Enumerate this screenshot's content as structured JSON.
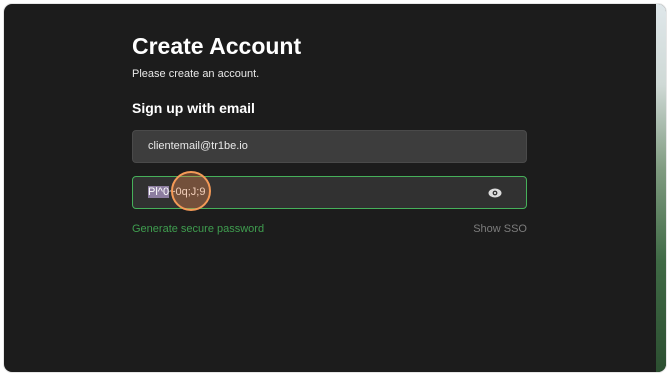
{
  "form": {
    "title": "Create Account",
    "subtitle": "Please create an account.",
    "section_title": "Sign up with email",
    "email_value": "clientemail@tr1be.io",
    "password_selected": "Pl^0",
    "password_rest": "~0q;J;9",
    "generate_link": "Generate secure password",
    "sso_link": "Show SSO"
  },
  "icons": {
    "visibility": "eye-icon"
  },
  "colors": {
    "background": "#1c1c1c",
    "accent_green": "#46b05a",
    "link_green": "#3f9d4f",
    "muted_link": "#7c7c7c"
  }
}
